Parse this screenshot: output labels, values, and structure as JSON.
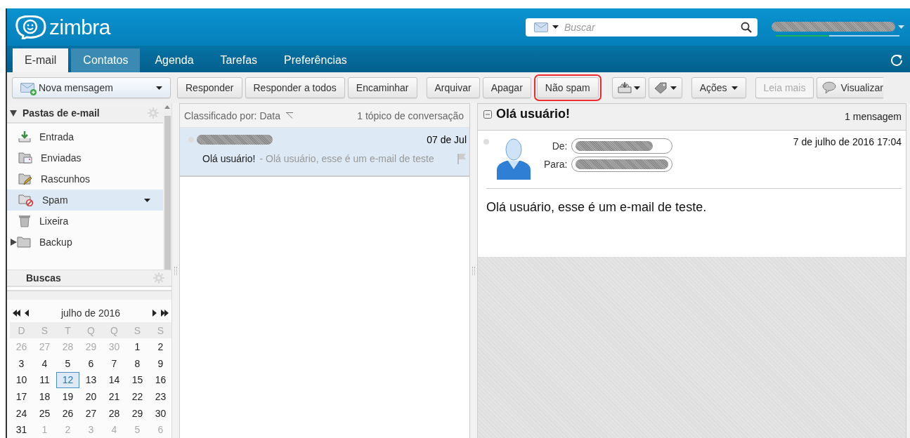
{
  "app": {
    "logo_text": "zimbra"
  },
  "search": {
    "placeholder": "Buscar"
  },
  "account": {
    "quota": {
      "level": 0.43
    }
  },
  "tabs": [
    {
      "label": "E-mail",
      "selected": true,
      "hovered": false
    },
    {
      "label": "Contatos",
      "selected": false,
      "hovered": true
    },
    {
      "label": "Agenda",
      "selected": false,
      "hovered": false
    },
    {
      "label": "Tarefas",
      "selected": false,
      "hovered": false
    },
    {
      "label": "Preferências",
      "selected": false,
      "hovered": false
    }
  ],
  "toolbar": {
    "new_message": "Nova mensagem",
    "groups": [
      {
        "buttons": [
          {
            "kind": "text",
            "label": "Responder",
            "disabled": false,
            "highlighted": false
          },
          {
            "kind": "text",
            "label": "Responder a todos",
            "disabled": false,
            "highlighted": false
          },
          {
            "kind": "text",
            "label": "Encaminhar",
            "disabled": false,
            "highlighted": false
          }
        ]
      },
      {
        "buttons": [
          {
            "kind": "text",
            "label": "Arquivar",
            "disabled": false,
            "highlighted": false
          },
          {
            "kind": "text",
            "label": "Apagar",
            "disabled": false,
            "highlighted": false
          },
          {
            "kind": "text",
            "label": "Não spam",
            "disabled": false,
            "highlighted": true
          }
        ]
      },
      {
        "buttons": [
          {
            "kind": "move",
            "disabled": false,
            "highlighted": false
          },
          {
            "kind": "tag",
            "disabled": false,
            "highlighted": false
          }
        ]
      },
      {
        "buttons": [
          {
            "kind": "menu",
            "label": "Ações",
            "disabled": false,
            "highlighted": false
          }
        ]
      },
      {
        "buttons": [
          {
            "kind": "text",
            "label": "Leia mais",
            "disabled": true,
            "highlighted": false
          },
          {
            "kind": "view",
            "label": "Visualizar",
            "disabled": false,
            "highlighted": false
          }
        ]
      }
    ]
  },
  "sidebar": {
    "folders": {
      "title": "Pastas de e-mail",
      "expanded": true,
      "items": [
        {
          "kind": "inbox",
          "label": "Entrada",
          "selected": false
        },
        {
          "kind": "sent",
          "label": "Enviadas",
          "selected": false
        },
        {
          "kind": "drafts",
          "label": "Rascunhos",
          "selected": false
        },
        {
          "kind": "spam",
          "label": "Spam",
          "selected": true
        },
        {
          "kind": "trash",
          "label": "Lixeira",
          "selected": false
        },
        {
          "kind": "folder",
          "label": "Backup",
          "selected": false,
          "expanded": false
        }
      ]
    },
    "searches": {
      "title": "Buscas"
    }
  },
  "calendar": {
    "month": "julho de 2016",
    "weekdays": [
      "D",
      "S",
      "T",
      "Q",
      "Q",
      "S",
      "S"
    ],
    "days": [
      {
        "d": "26",
        "other_month": true,
        "selected": false
      },
      {
        "d": "27",
        "other_month": true,
        "selected": false
      },
      {
        "d": "28",
        "other_month": true,
        "selected": false
      },
      {
        "d": "29",
        "other_month": true,
        "selected": false
      },
      {
        "d": "30",
        "other_month": true,
        "selected": false
      },
      {
        "d": "1",
        "other_month": false,
        "selected": false
      },
      {
        "d": "2",
        "other_month": false,
        "selected": false
      },
      {
        "d": "3",
        "other_month": false,
        "selected": false
      },
      {
        "d": "4",
        "other_month": false,
        "selected": false
      },
      {
        "d": "5",
        "other_month": false,
        "selected": false
      },
      {
        "d": "6",
        "other_month": false,
        "selected": false
      },
      {
        "d": "7",
        "other_month": false,
        "selected": false
      },
      {
        "d": "8",
        "other_month": false,
        "selected": false
      },
      {
        "d": "9",
        "other_month": false,
        "selected": false
      },
      {
        "d": "10",
        "other_month": false,
        "selected": false
      },
      {
        "d": "11",
        "other_month": false,
        "selected": false
      },
      {
        "d": "12",
        "other_month": false,
        "selected": true
      },
      {
        "d": "13",
        "other_month": false,
        "selected": false
      },
      {
        "d": "14",
        "other_month": false,
        "selected": false
      },
      {
        "d": "15",
        "other_month": false,
        "selected": false
      },
      {
        "d": "16",
        "other_month": false,
        "selected": false
      },
      {
        "d": "17",
        "other_month": false,
        "selected": false
      },
      {
        "d": "18",
        "other_month": false,
        "selected": false
      },
      {
        "d": "19",
        "other_month": false,
        "selected": false
      },
      {
        "d": "20",
        "other_month": false,
        "selected": false
      },
      {
        "d": "21",
        "other_month": false,
        "selected": false
      },
      {
        "d": "22",
        "other_month": false,
        "selected": false
      },
      {
        "d": "23",
        "other_month": false,
        "selected": false
      },
      {
        "d": "24",
        "other_month": false,
        "selected": false
      },
      {
        "d": "25",
        "other_month": false,
        "selected": false
      },
      {
        "d": "26",
        "other_month": false,
        "selected": false
      },
      {
        "d": "27",
        "other_month": false,
        "selected": false
      },
      {
        "d": "28",
        "other_month": false,
        "selected": false
      },
      {
        "d": "29",
        "other_month": false,
        "selected": false
      },
      {
        "d": "30",
        "other_month": false,
        "selected": false
      },
      {
        "d": "31",
        "other_month": false,
        "selected": false
      },
      {
        "d": "1",
        "other_month": true,
        "selected": false
      },
      {
        "d": "2",
        "other_month": true,
        "selected": false
      },
      {
        "d": "3",
        "other_month": true,
        "selected": false
      },
      {
        "d": "4",
        "other_month": true,
        "selected": false
      },
      {
        "d": "5",
        "other_month": true,
        "selected": false
      },
      {
        "d": "6",
        "other_month": true,
        "selected": false
      }
    ]
  },
  "message_list": {
    "sort_label": "Classificado por: Data",
    "count": "1 tópico de conversação",
    "messages": [
      {
        "date": "07 de Jul",
        "subject": "Olá usuário!",
        "fragment": "- Olá usuário, esse é um e-mail de teste",
        "selected": true,
        "flagged": false
      }
    ]
  },
  "reader": {
    "subject": "Olá usuário!",
    "count": "1 mensagem",
    "from_label": "De:",
    "to_label": "Para:",
    "date": "7 de julho de 2016 17:04",
    "body": "Olá usuário, esse é um e-mail de teste."
  }
}
